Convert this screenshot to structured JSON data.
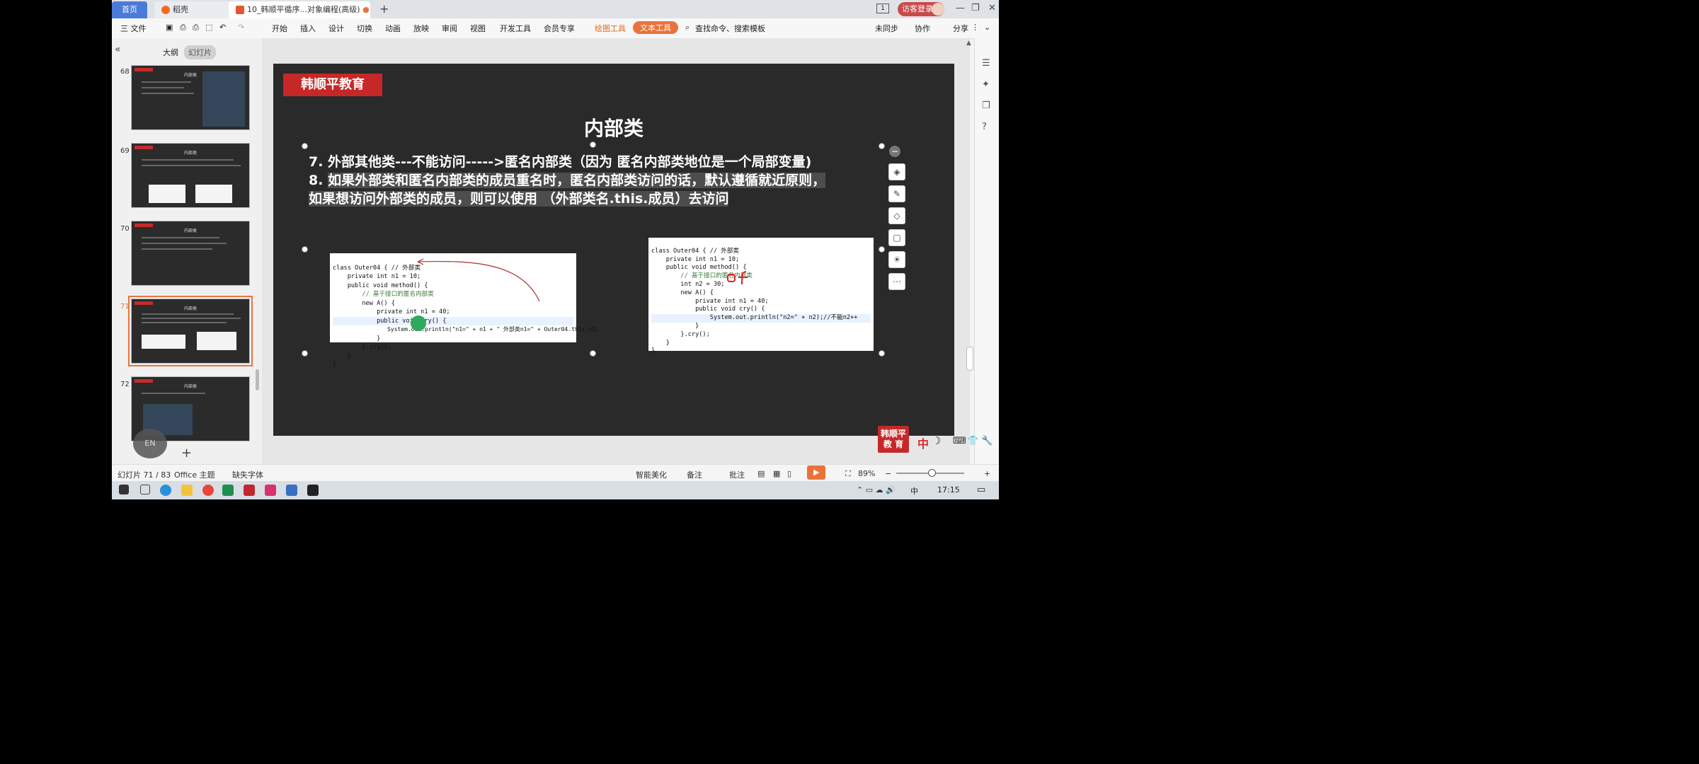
{
  "tabs": {
    "home": "首页",
    "daoke": "稻壳",
    "active": "10_韩顺平循序...对象编程(高级)",
    "new_tab": "+"
  },
  "titlebar": {
    "login": "访客登录",
    "page_badge": "1"
  },
  "toolbar": {
    "file": "三 文件",
    "menus": [
      "开始",
      "插入",
      "设计",
      "切换",
      "动画",
      "放映",
      "审阅",
      "视图",
      "开发工具",
      "会员专享"
    ],
    "drawing_tools": "绘图工具",
    "text_tools": "文本工具",
    "search": "查找命令、搜索模板",
    "unsynced": "未同步",
    "collab": "协作",
    "share": "分享"
  },
  "sidebar": {
    "outline": "大纲",
    "slides": "幻灯片",
    "thumbnails": [
      {
        "num": "68",
        "title": "内部类"
      },
      {
        "num": "69",
        "title": "内部类"
      },
      {
        "num": "70",
        "title": "内部类"
      },
      {
        "num": "71",
        "title": "内部类"
      },
      {
        "num": "72",
        "title": "内部类"
      }
    ],
    "add": "+"
  },
  "slide": {
    "brand": "韩顺平教育",
    "title": "内部类",
    "line7": "7. 外部其他类---不能访问----->匿名内部类（因为 匿名内部类地位是一个局部变量)",
    "line8_prefix": "8. ",
    "line8a": "如果外部类和匿名内部类的成员重名时，匿名内部类访问的话，默认遵循就近原则，",
    "line8b": "如果想访问外部类的成员，则可以使用 （外部类名.this.成员）去访问",
    "code_left": [
      "class Outer04 { // 外部类",
      "    private int n1 = 10;",
      "    public void method() {",
      "        // 基于接口的匿名内部类",
      "        new A() {",
      "            private int n1 = 40;",
      "            public void cry() {",
      "                System.out.println(\"n1=\" + n1 + \" 外部类n1=\" + Outer04.this.n1)",
      "            }",
      "        }.cry();",
      "    }",
      "}"
    ],
    "code_right": [
      "class Outer04 { // 外部类",
      "    private int n1 = 10;",
      "    public void method() {",
      "        // 基于接口的匿名内部类",
      "        int n2 = 30;",
      "        new A() {",
      "            private int n1 = 40;",
      "            public void cry() {",
      "                System.out.println(\"n2=\" + n2);//不能n2++",
      "            }",
      "        }.cry();",
      "    }",
      "}"
    ]
  },
  "watermark": {
    "line1": "韩顺平",
    "line2": "教 育",
    "ime": "中"
  },
  "status": {
    "slide_count": "幻灯片 71 / 83",
    "theme": "Office 主题",
    "missing_font": "缺失字体",
    "beautify": "智能美化",
    "notes": "备注",
    "comments": "批注",
    "zoom": "89%"
  },
  "taskbar": {
    "time": "17:15",
    "ime": "中"
  },
  "colors": {
    "accent": "#e8743b",
    "brand_red": "#c62828",
    "slide_bg": "#2a2a2a"
  }
}
